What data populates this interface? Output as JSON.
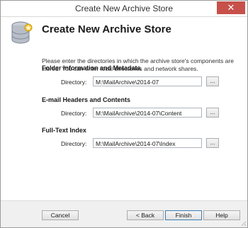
{
  "window": {
    "title": "Create New Archive Store",
    "close_glyph": "✕"
  },
  "header": {
    "heading": "Create New Archive Store",
    "icon": "database-icon"
  },
  "description": "Please enter the directories in which the archive store's components are stored. You can enter local directories and network shares.",
  "sections": [
    {
      "title": "Folder Information and Metadata",
      "label": "Directory:",
      "value": "M:\\MailArchive\\2014-07",
      "browse": "..."
    },
    {
      "title": "E-mail Headers and Contents",
      "label": "Directory:",
      "value": "M:\\MailArchive\\2014-07\\Content",
      "browse": "..."
    },
    {
      "title": "Full-Text Index",
      "label": "Directory:",
      "value": "M:\\MailArchive\\2014-07\\Index",
      "browse": "..."
    }
  ],
  "buttons": {
    "cancel": "Cancel",
    "back": "< Back",
    "finish": "Finish",
    "help": "Help"
  },
  "colors": {
    "close": "#c7504a",
    "accent": "#3c7fb1"
  }
}
